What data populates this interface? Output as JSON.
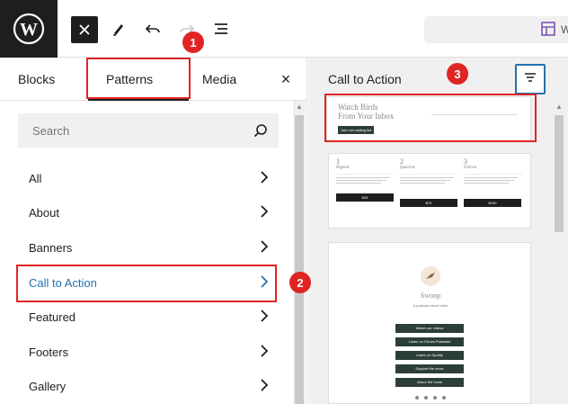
{
  "toolbar": {
    "site_icon": "wordpress-logo",
    "close_icon": "close-icon",
    "tools_icon": "pencil-icon",
    "undo_icon": "undo-icon",
    "redo_icon": "redo-icon",
    "list_view_icon": "list-view-icon",
    "document_bar_text": "W"
  },
  "inserter": {
    "tabs": [
      {
        "label": "Blocks"
      },
      {
        "label": "Patterns"
      },
      {
        "label": "Media"
      }
    ],
    "active_tab": "Patterns",
    "close_label": "×",
    "search": {
      "placeholder": "Search"
    },
    "categories": [
      {
        "label": "All"
      },
      {
        "label": "About"
      },
      {
        "label": "Banners"
      },
      {
        "label": "Call to Action"
      },
      {
        "label": "Featured"
      },
      {
        "label": "Footers"
      },
      {
        "label": "Gallery"
      }
    ],
    "selected_category": "Call to Action"
  },
  "patterns_panel": {
    "title": "Call to Action",
    "previews": {
      "p1": {
        "heading_line1": "Watch Birds",
        "heading_line2": "From Your Inbox",
        "button": "Join our mailing list"
      },
      "p2": {
        "columns": [
          {
            "num": "1",
            "name": "Pigeon",
            "button": "$25"
          },
          {
            "num": "2",
            "name": "Sparrow",
            "button": "$75"
          },
          {
            "num": "3",
            "name": "Falcon",
            "button": "$100"
          }
        ]
      },
      "p3": {
        "title": "Swoop",
        "subtitle": "A podcast about birds",
        "buttons": [
          "Watch our videos",
          "Listen on iTunes Podcasts",
          "Listen on Spotify",
          "Support the show",
          "About the hosts"
        ]
      }
    }
  },
  "annotations": {
    "badges": [
      "1",
      "2",
      "3"
    ]
  },
  "colors": {
    "highlight": "#e02424",
    "accent": "#2271b1",
    "dark": "#1e1e1e"
  }
}
